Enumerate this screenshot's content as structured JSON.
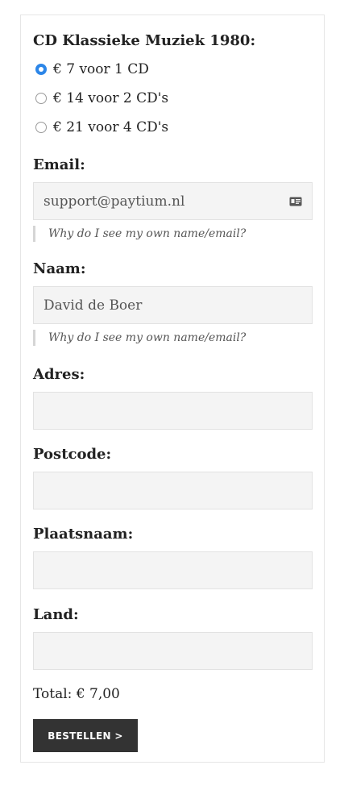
{
  "form": {
    "title": "CD Klassieke Muziek 1980:",
    "options": [
      {
        "label": "€ 7 voor 1 CD",
        "checked": true
      },
      {
        "label": "€ 14 voor 2 CD's",
        "checked": false
      },
      {
        "label": "€ 21 voor 4 CD's",
        "checked": false
      }
    ],
    "email": {
      "label": "Email:",
      "value": "support@paytium.nl",
      "icon": "contact-card-icon",
      "hint": "Why do I see my own name/email?"
    },
    "naam": {
      "label": "Naam:",
      "value": "David de Boer",
      "hint": "Why do I see my own name/email?"
    },
    "adres": {
      "label": "Adres:",
      "value": ""
    },
    "postcode": {
      "label": "Postcode:",
      "value": ""
    },
    "plaatsnaam": {
      "label": "Plaatsnaam:",
      "value": ""
    },
    "land": {
      "label": "Land:",
      "value": ""
    },
    "total": "Total: € 7,00",
    "submit_label": "BESTELLEN >"
  },
  "colors": {
    "accent": "#2c86e8",
    "button_bg": "#333333",
    "field_bg": "#f4f4f4"
  }
}
